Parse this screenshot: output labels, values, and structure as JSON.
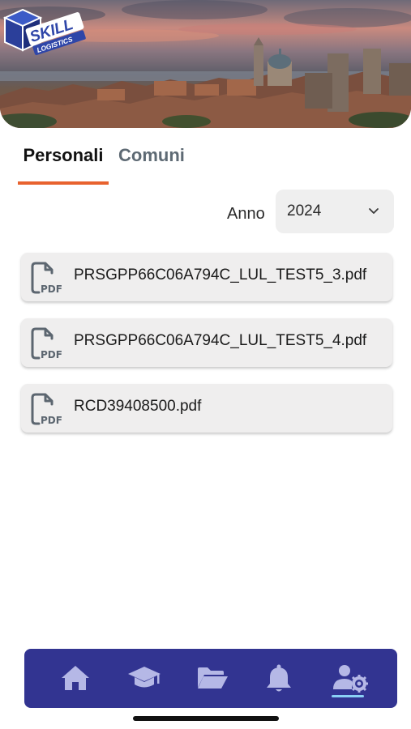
{
  "header": {
    "logo_text": "SKILL LOGISTICS",
    "banner_icon": "city-skyline-photo"
  },
  "tabs": [
    {
      "label": "Personali",
      "active": true
    },
    {
      "label": "Comuni",
      "active": false
    }
  ],
  "filter": {
    "year_label": "Anno",
    "year_value": "2024",
    "dropdown_icon": "chevron-down-icon"
  },
  "files": [
    {
      "name": "PRSGPP66C06A794C_LUL_TEST5_3.pdf",
      "icon": "pdf-file-icon"
    },
    {
      "name": "PRSGPP66C06A794C_LUL_TEST5_4.pdf",
      "icon": "pdf-file-icon"
    },
    {
      "name": "RCD39408500.pdf",
      "icon": "pdf-file-icon"
    }
  ],
  "pdf_icon_label": "PDF",
  "bottom_nav": {
    "items": [
      {
        "icon": "home-icon",
        "active": false
      },
      {
        "icon": "graduation-cap-icon",
        "active": false
      },
      {
        "icon": "folder-open-icon",
        "active": false
      },
      {
        "icon": "bell-icon",
        "active": false
      },
      {
        "icon": "user-settings-icon",
        "active": true
      }
    ]
  },
  "colors": {
    "accent": "#e8622e",
    "nav_background": "#323491",
    "nav_icon": "#b5b8e6",
    "active_indicator": "#8ad0f5",
    "logo_blue": "#2f46a8"
  }
}
